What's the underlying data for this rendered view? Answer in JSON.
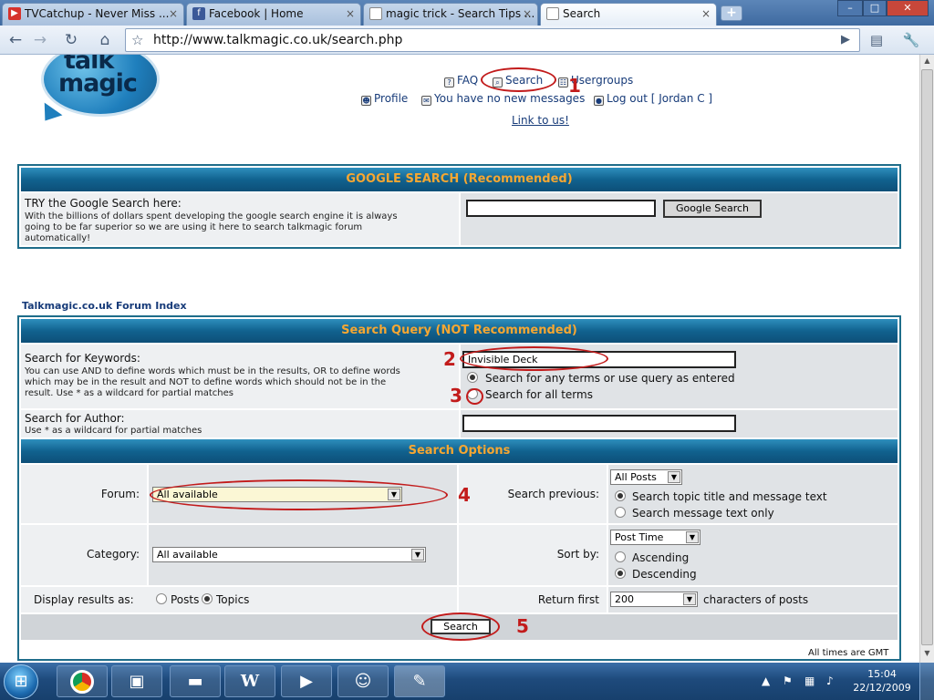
{
  "browser": {
    "tabs": [
      {
        "label": "TVCatchup - Never Miss ...",
        "favicon": "tv-icon"
      },
      {
        "label": "Facebook | Home",
        "favicon": "facebook-icon"
      },
      {
        "label": "magic trick - Search Tips ...",
        "favicon": "page-icon"
      },
      {
        "label": "Search",
        "favicon": "page-icon",
        "active": true
      }
    ],
    "new_tab": "+",
    "url": "http://www.talkmagic.co.uk/search.php",
    "window_buttons": [
      "–",
      "□",
      "✕"
    ]
  },
  "site": {
    "logo_line1": "talk",
    "logo_line2": "magic",
    "nav": {
      "faq": "FAQ",
      "search": "Search",
      "usergroups": "Usergroups",
      "profile": "Profile",
      "messages": "You have no new messages",
      "logout": "Log out [ Jordan C ]",
      "link_us": "Link to us!"
    }
  },
  "google_search": {
    "header": "GOOGLE SEARCH (Recommended)",
    "title": "TRY the Google Search here:",
    "desc_lines": [
      "With the billions of dollars spent developing the google search engine it is always",
      "going to be far superior so we are using it here to search talkmagic forum",
      "automatically!"
    ],
    "input_value": "",
    "button": "Google Search"
  },
  "forum_index_link": "Talkmagic.co.uk Forum Index",
  "search_query": {
    "header": "Search Query (NOT Recommended)",
    "keywords_label": "Search for Keywords:",
    "keywords_help_lines": [
      "You can use AND to define words which must be in the results, OR to define words",
      "which may be in the result and NOT to define words which should not be in the",
      "result. Use * as a wildcard for partial matches"
    ],
    "keywords_value": "Invisible Deck",
    "radio_any": "Search for any terms or use query as entered",
    "radio_all": "Search for all terms",
    "author_label": "Search for Author:",
    "author_help": "Use * as a wildcard for partial matches",
    "author_value": ""
  },
  "search_options": {
    "header": "Search Options",
    "forum_label": "Forum:",
    "forum_value": "All available",
    "search_previous_label": "Search previous:",
    "search_previous_value": "All Posts",
    "radio_title_text": "Search topic title and message text",
    "radio_text_only": "Search message text only",
    "category_label": "Category:",
    "category_value": "All available",
    "sort_by_label": "Sort by:",
    "sort_by_value": "Post Time",
    "radio_ascending": "Ascending",
    "radio_descending": "Descending",
    "display_label": "Display results as:",
    "display_posts": "Posts",
    "display_topics": "Topics",
    "return_first_label": "Return first",
    "return_first_value": "200",
    "characters_label": "characters of posts",
    "search_button": "Search"
  },
  "footer_note": "All times are GMT",
  "annotations": [
    "1",
    "2",
    "3",
    "4",
    "5"
  ],
  "taskbar": {
    "start": "⊞",
    "items": [
      "chrome-icon",
      "window-icon",
      "folder-icon",
      "word-icon",
      "media-icon",
      "people-icon",
      "paint-icon"
    ],
    "word_letter": "W",
    "time": "15:04",
    "date": "22/12/2009"
  },
  "colors": {
    "header_bg": "#11628f",
    "header_text": "#f6a732",
    "annotation_red": "#c21b1b",
    "link": "#173b79"
  }
}
